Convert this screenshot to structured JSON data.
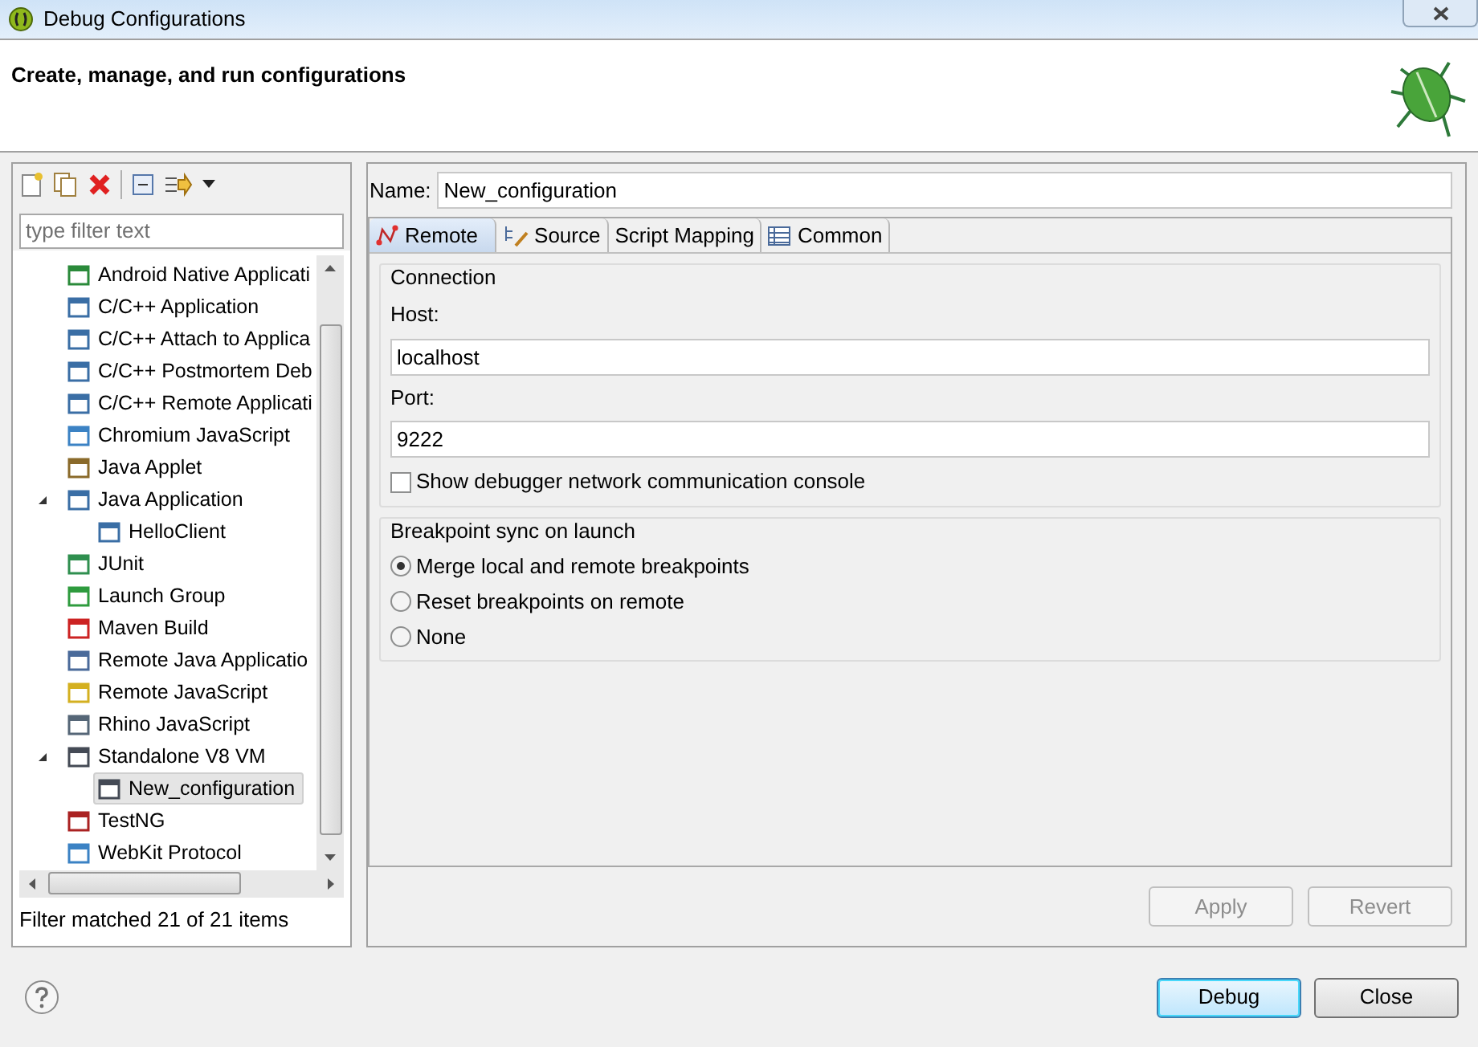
{
  "window": {
    "title": "Debug Configurations"
  },
  "header": {
    "title": "Create, manage, and run configurations"
  },
  "filter": {
    "placeholder": "type filter text"
  },
  "tree": [
    {
      "label": "Android Native Applicati",
      "selected": false
    },
    {
      "label": "C/C++ Application",
      "selected": false
    },
    {
      "label": "C/C++ Attach to Applica",
      "selected": false
    },
    {
      "label": "C/C++ Postmortem Deb",
      "selected": false
    },
    {
      "label": "C/C++ Remote Applicati",
      "selected": false
    },
    {
      "label": "Chromium JavaScript",
      "selected": false
    },
    {
      "label": "Java Applet",
      "selected": false
    },
    {
      "label": "Java Application",
      "selected": false,
      "expanded": true,
      "children": [
        {
          "label": "HelloClient",
          "selected": false
        }
      ]
    },
    {
      "label": "JUnit",
      "selected": false
    },
    {
      "label": "Launch Group",
      "selected": false
    },
    {
      "label": "Maven Build",
      "selected": false
    },
    {
      "label": "Remote Java Applicatio",
      "selected": false
    },
    {
      "label": "Remote JavaScript",
      "selected": false
    },
    {
      "label": "Rhino JavaScript",
      "selected": false
    },
    {
      "label": "Standalone V8 VM",
      "selected": false,
      "expanded": true,
      "children": [
        {
          "label": "New_configuration",
          "selected": true
        }
      ]
    },
    {
      "label": "TestNG",
      "selected": false
    },
    {
      "label": "WebKit Protocol",
      "selected": false
    }
  ],
  "filter_status": "Filter matched 21 of 21 items",
  "name": {
    "label": "Name:",
    "value": "New_configuration"
  },
  "tabs": [
    {
      "label": "Remote",
      "selected": true
    },
    {
      "label": "Source",
      "selected": false
    },
    {
      "label": "Script Mapping",
      "selected": false
    },
    {
      "label": "Common",
      "selected": false
    }
  ],
  "connection": {
    "title": "Connection",
    "host_label": "Host:",
    "host": "localhost",
    "port_label": "Port:",
    "port": "9222",
    "console": {
      "label": "Show debugger network communication console",
      "checked": false
    }
  },
  "breakpoint_sync": {
    "title": "Breakpoint sync on launch",
    "options": [
      {
        "label": "Merge local and remote breakpoints",
        "selected": true
      },
      {
        "label": "Reset breakpoints on remote",
        "selected": false
      },
      {
        "label": "None",
        "selected": false
      }
    ]
  },
  "panel_buttons": [
    {
      "label": "Apply",
      "disabled": true
    },
    {
      "label": "Revert",
      "disabled": true
    }
  ],
  "dialog_buttons": [
    {
      "label": "Debug",
      "default": true
    },
    {
      "label": "Close",
      "default": false
    }
  ]
}
